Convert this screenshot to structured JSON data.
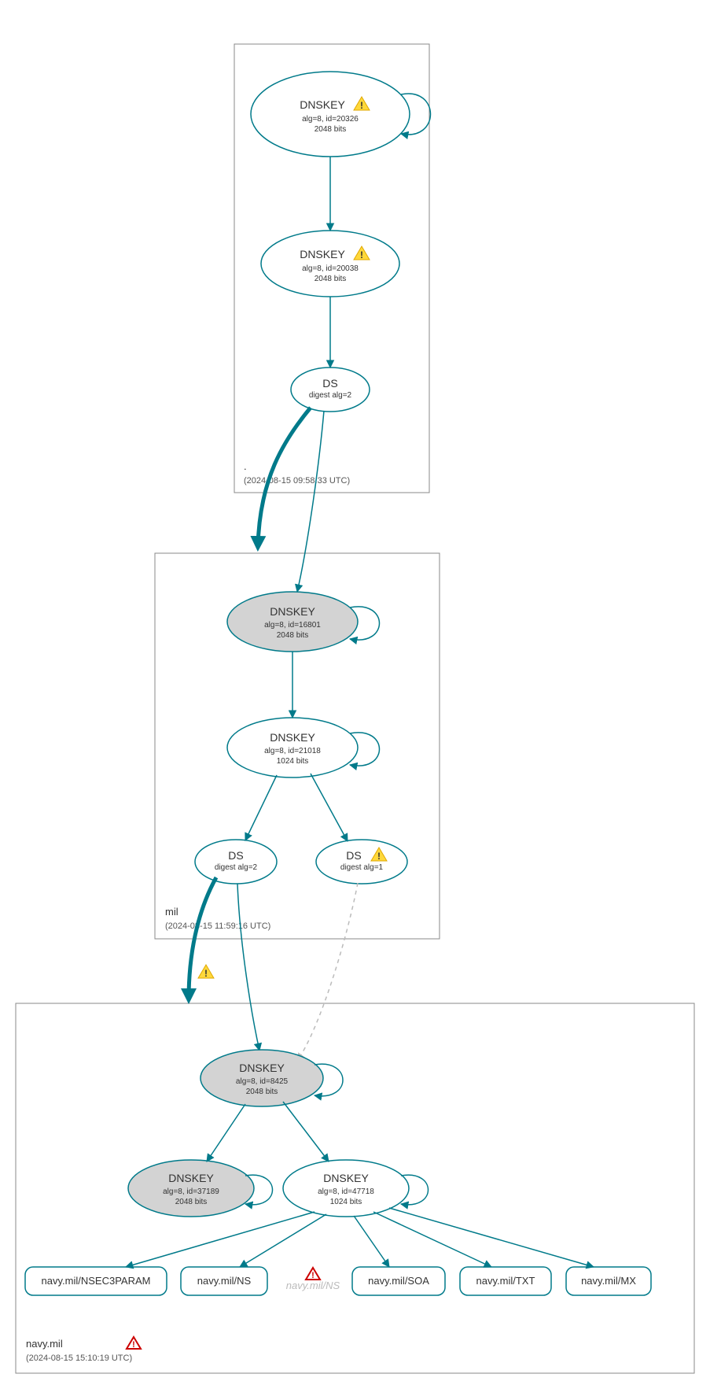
{
  "chart_data": {
    "type": "diagram",
    "zones": [
      {
        "name": ".",
        "timestamp": "(2024-08-15 09:58:33 UTC)",
        "nodes": [
          {
            "id": "root_ksk",
            "type": "DNSKEY",
            "sub": "alg=8, id=20326",
            "bits": "2048 bits",
            "ksk": true,
            "warn": true,
            "self_loop": true
          },
          {
            "id": "root_zsk",
            "type": "DNSKEY",
            "sub": "alg=8, id=20038",
            "bits": "2048 bits",
            "warn": true
          },
          {
            "id": "root_ds",
            "type": "DS",
            "sub": "digest alg=2"
          }
        ],
        "edges": [
          {
            "from": "root_ksk",
            "to": "root_zsk"
          },
          {
            "from": "root_zsk",
            "to": "root_ds"
          }
        ]
      },
      {
        "name": "mil",
        "timestamp": "(2024-08-15 11:59:16 UTC)",
        "nodes": [
          {
            "id": "mil_ksk",
            "type": "DNSKEY",
            "sub": "alg=8, id=16801",
            "bits": "2048 bits",
            "ksk": true,
            "self_loop": true
          },
          {
            "id": "mil_zsk",
            "type": "DNSKEY",
            "sub": "alg=8, id=21018",
            "bits": "1024 bits",
            "self_loop": true
          },
          {
            "id": "mil_ds1",
            "type": "DS",
            "sub": "digest alg=2"
          },
          {
            "id": "mil_ds2",
            "type": "DS",
            "sub": "digest alg=1",
            "warn": true
          }
        ],
        "edges": [
          {
            "from": "root_ds",
            "to": "mil_ksk",
            "thick_deleg": true
          },
          {
            "from": "root_ds",
            "to": "mil_ksk"
          },
          {
            "from": "mil_ksk",
            "to": "mil_zsk"
          },
          {
            "from": "mil_zsk",
            "to": "mil_ds1"
          },
          {
            "from": "mil_zsk",
            "to": "mil_ds2"
          }
        ]
      },
      {
        "name": "navy.mil",
        "timestamp": "(2024-08-15 15:10:19 UTC)",
        "warn_red": true,
        "nodes": [
          {
            "id": "navy_ksk",
            "type": "DNSKEY",
            "sub": "alg=8, id=8425",
            "bits": "2048 bits",
            "ksk": true,
            "self_loop": true
          },
          {
            "id": "navy_zsk1",
            "type": "DNSKEY",
            "sub": "alg=8, id=37189",
            "bits": "2048 bits",
            "ksk": true,
            "self_loop": true
          },
          {
            "id": "navy_zsk2",
            "type": "DNSKEY",
            "sub": "alg=8, id=47718",
            "bits": "1024 bits",
            "self_loop": true
          },
          {
            "id": "rec_nsec3",
            "type": "record",
            "label": "navy.mil/NSEC3PARAM"
          },
          {
            "id": "rec_ns",
            "type": "record",
            "label": "navy.mil/NS"
          },
          {
            "id": "rec_ns_bad",
            "type": "record_bad",
            "label": "navy.mil/NS",
            "warn_red": true
          },
          {
            "id": "rec_soa",
            "type": "record",
            "label": "navy.mil/SOA"
          },
          {
            "id": "rec_txt",
            "type": "record",
            "label": "navy.mil/TXT"
          },
          {
            "id": "rec_mx",
            "type": "record",
            "label": "navy.mil/MX"
          }
        ],
        "edges": [
          {
            "from": "mil_ds1",
            "to": "navy_ksk",
            "thick_deleg": true,
            "warn": true
          },
          {
            "from": "mil_ds1",
            "to": "navy_ksk"
          },
          {
            "from": "mil_ds2",
            "to": "navy_ksk",
            "dashed": true
          },
          {
            "from": "navy_ksk",
            "to": "navy_zsk1"
          },
          {
            "from": "navy_ksk",
            "to": "navy_zsk2"
          },
          {
            "from": "navy_zsk2",
            "to": "rec_nsec3"
          },
          {
            "from": "navy_zsk2",
            "to": "rec_ns"
          },
          {
            "from": "navy_zsk2",
            "to": "rec_soa"
          },
          {
            "from": "navy_zsk2",
            "to": "rec_txt"
          },
          {
            "from": "navy_zsk2",
            "to": "rec_mx"
          }
        ]
      }
    ]
  },
  "labels": {
    "dnskey": "DNSKEY",
    "ds": "DS",
    "root_ksk_sub": "alg=8, id=20326",
    "root_ksk_bits": "2048 bits",
    "root_zsk_sub": "alg=8, id=20038",
    "root_zsk_bits": "2048 bits",
    "root_ds_sub": "digest alg=2",
    "mil_ksk_sub": "alg=8, id=16801",
    "mil_ksk_bits": "2048 bits",
    "mil_zsk_sub": "alg=8, id=21018",
    "mil_zsk_bits": "1024 bits",
    "mil_ds1_sub": "digest alg=2",
    "mil_ds2_sub": "digest alg=1",
    "navy_ksk_sub": "alg=8, id=8425",
    "navy_ksk_bits": "2048 bits",
    "navy_zsk1_sub": "alg=8, id=37189",
    "navy_zsk1_bits": "2048 bits",
    "navy_zsk2_sub": "alg=8, id=47718",
    "navy_zsk2_bits": "1024 bits",
    "rec_nsec3": "navy.mil/NSEC3PARAM",
    "rec_ns": "navy.mil/NS",
    "rec_ns_bad": "navy.mil/NS",
    "rec_soa": "navy.mil/SOA",
    "rec_txt": "navy.mil/TXT",
    "rec_mx": "navy.mil/MX",
    "zone_root": ".",
    "zone_root_time": "(2024-08-15 09:58:33 UTC)",
    "zone_mil": "mil",
    "zone_mil_time": "(2024-08-15 11:59:16 UTC)",
    "zone_navy": "navy.mil",
    "zone_navy_time": "(2024-08-15 15:10:19 UTC)"
  }
}
